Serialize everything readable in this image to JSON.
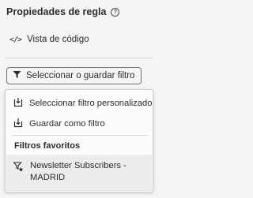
{
  "panel": {
    "title": "Propiedades de regla",
    "help_icon": "help-circle-icon"
  },
  "code_view": {
    "icon": "code-icon",
    "label": "Vista de código"
  },
  "filter_button": {
    "icon": "filter-icon",
    "label": "Seleccionar o guardar filtro"
  },
  "menu": {
    "items": [
      {
        "icon": "select-filter-icon",
        "label": "Seleccionar filtro personalizado"
      },
      {
        "icon": "save-icon",
        "label": "Guardar como filtro"
      }
    ],
    "favorites_heading": "Filtros favoritos",
    "favorites": [
      {
        "icon": "favorite-filter-icon",
        "label": "Newsletter Subscribers - MADRID"
      }
    ]
  }
}
